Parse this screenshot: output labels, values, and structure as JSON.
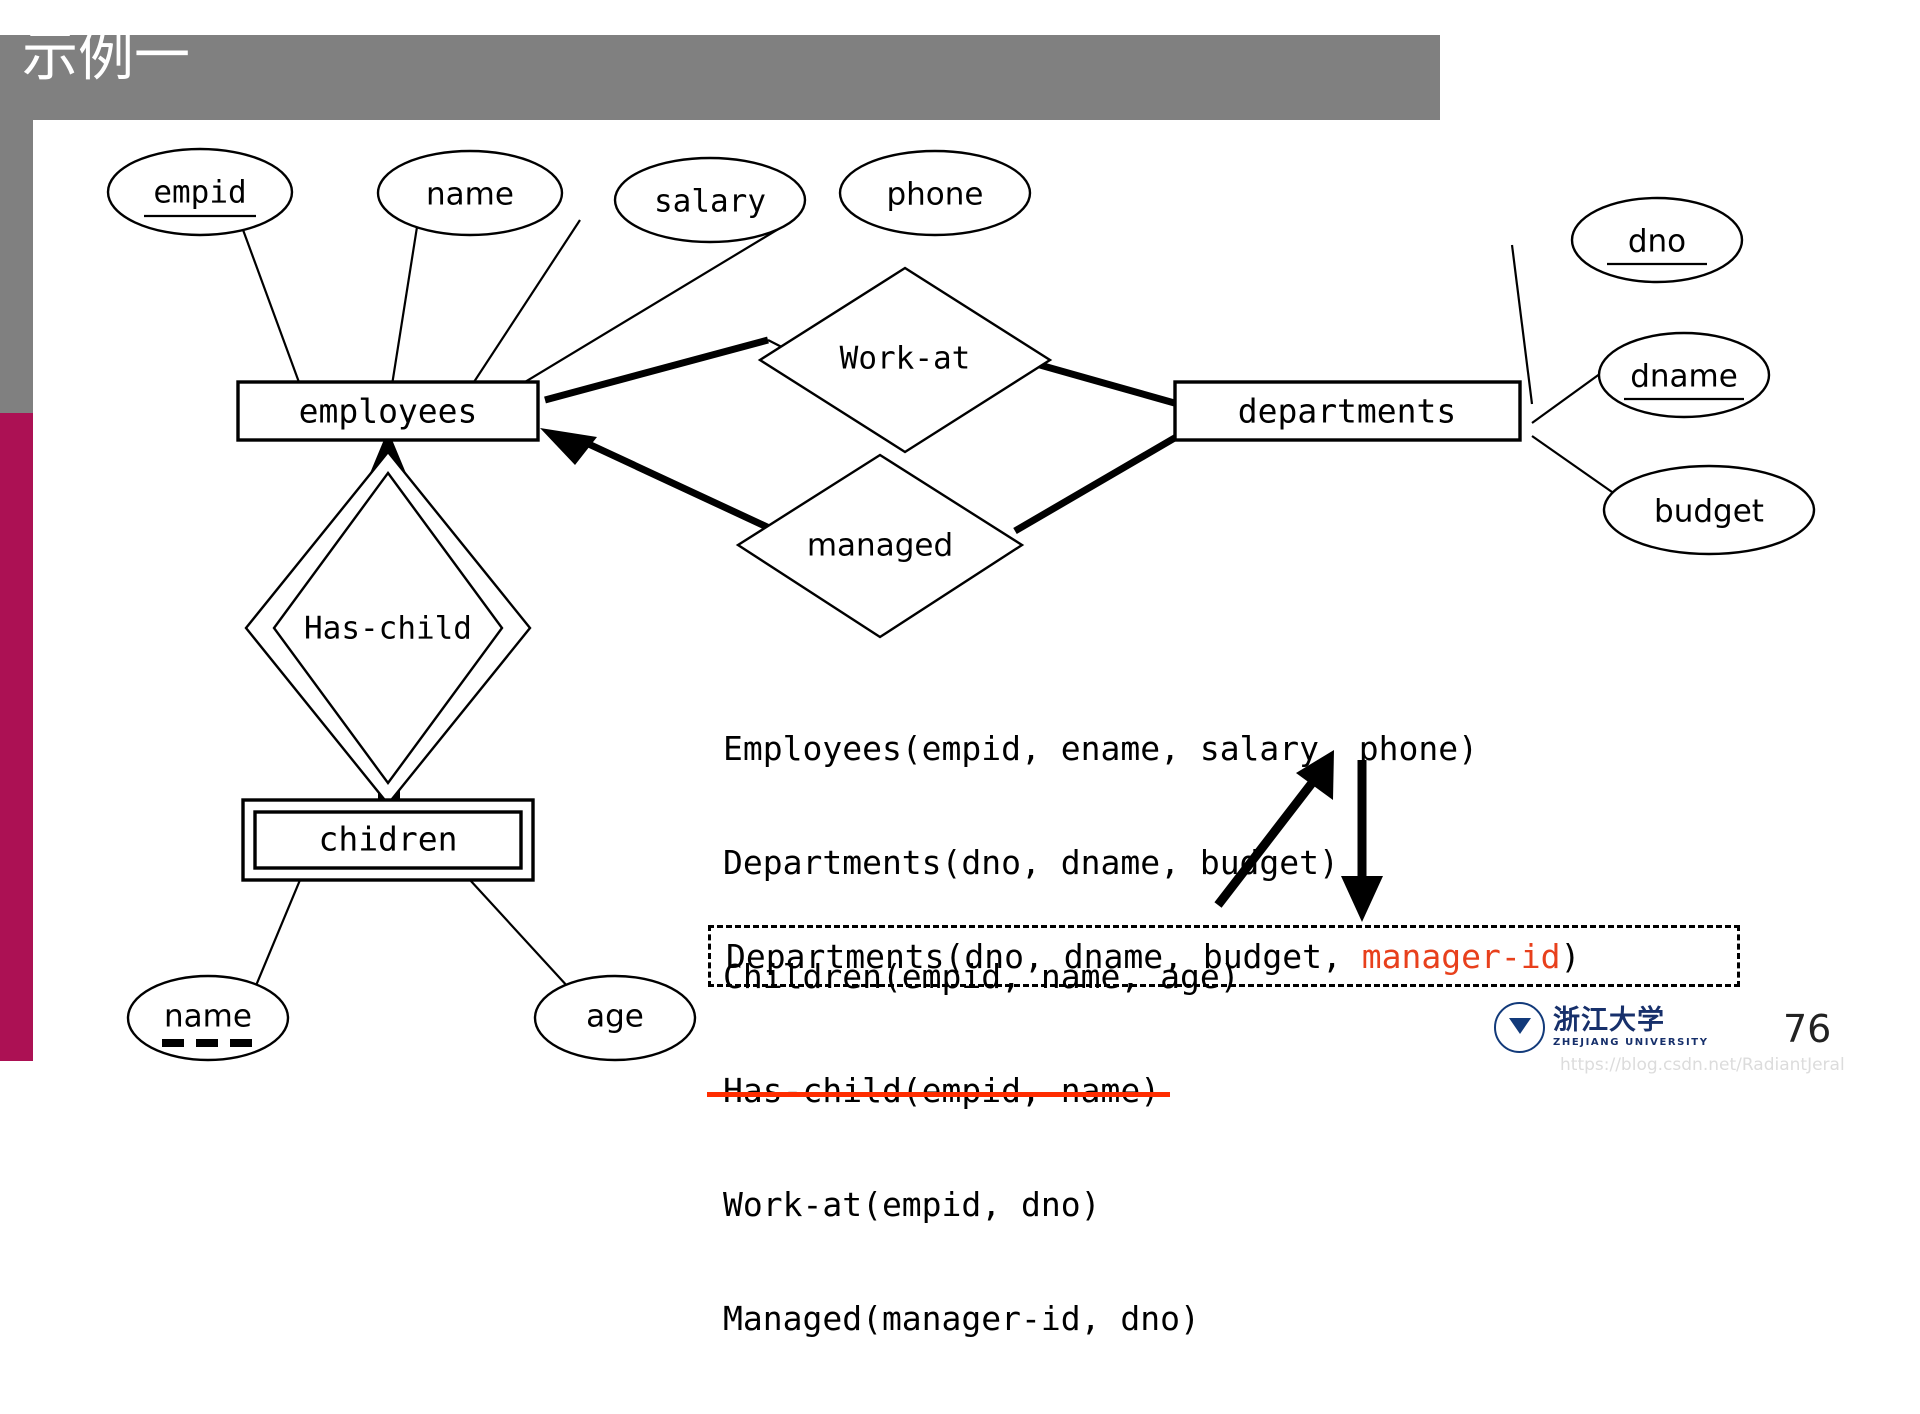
{
  "slide": {
    "title": "示例一",
    "page_number": "76",
    "watermark": "https://blog.csdn.net/RadiantJeral",
    "colors": {
      "banner": "#808080",
      "side_accent": "#AC1154",
      "strikethrough": "#FF2D00",
      "highlight_text": "#E8401C"
    }
  },
  "logo": {
    "name_cn": "浙江大学",
    "name_en": "ZHEJIANG UNIVERSITY"
  },
  "er_diagram": {
    "entities": [
      {
        "id": "employees",
        "label": "employees",
        "kind": "strong"
      },
      {
        "id": "departments",
        "label": "departments",
        "kind": "strong"
      },
      {
        "id": "children",
        "label": "chidren",
        "kind": "weak"
      }
    ],
    "relationships": [
      {
        "id": "work-at",
        "label": "Work-at",
        "kind": "normal"
      },
      {
        "id": "managed",
        "label": "managed",
        "kind": "normal"
      },
      {
        "id": "has-child",
        "label": "Has-child",
        "kind": "identifying"
      }
    ],
    "attributes": [
      {
        "id": "empid",
        "label": "empid",
        "owner": "employees",
        "underline": "solid"
      },
      {
        "id": "ename",
        "label": "name",
        "owner": "employees",
        "underline": "none"
      },
      {
        "id": "salary",
        "label": "salary",
        "owner": "employees",
        "underline": "none"
      },
      {
        "id": "phone",
        "label": "phone",
        "owner": "employees",
        "underline": "none"
      },
      {
        "id": "dno",
        "label": "dno",
        "owner": "departments",
        "underline": "solid"
      },
      {
        "id": "dname",
        "label": "dname",
        "owner": "departments",
        "underline": "solid"
      },
      {
        "id": "budget",
        "label": "budget",
        "owner": "departments",
        "underline": "none"
      },
      {
        "id": "cname",
        "label": "name",
        "owner": "children",
        "underline": "dashed"
      },
      {
        "id": "cage",
        "label": "age",
        "owner": "children",
        "underline": "none"
      }
    ]
  },
  "schema": {
    "lines": [
      {
        "text": "Employees(empid, ename, salary, phone)",
        "struck": false
      },
      {
        "text": "Departments(dno, dname, budget)",
        "struck": false
      },
      {
        "text": "Children(empid, name, age)",
        "struck": false
      },
      {
        "text": "Has-child(empid, name)",
        "struck": true
      },
      {
        "text": "Work-at(empid, dno)",
        "struck": false
      },
      {
        "text": "Managed(manager-id, dno)",
        "struck": false
      }
    ],
    "result_prefix": "Departments(dno, dname, budget, ",
    "result_highlight": "manager-id",
    "result_suffix": ")"
  }
}
